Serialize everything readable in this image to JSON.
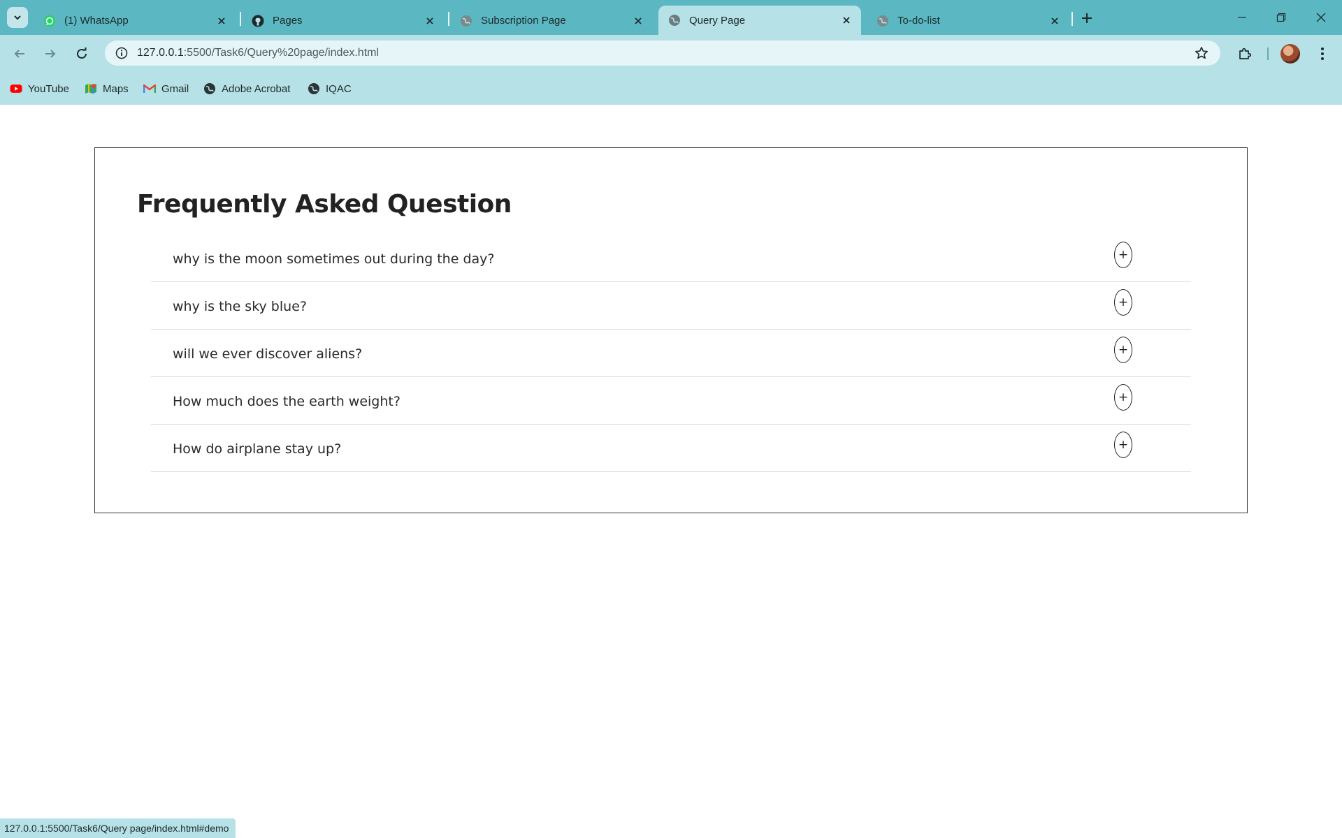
{
  "tabs": [
    {
      "title": "(1) WhatsApp",
      "icon": "whatsapp-icon"
    },
    {
      "title": "Pages",
      "icon": "github-icon"
    },
    {
      "title": "Subscription Page",
      "icon": "globe-icon"
    },
    {
      "title": "Query Page",
      "icon": "globe-icon",
      "active": true
    },
    {
      "title": "To-do-list",
      "icon": "globe-icon"
    }
  ],
  "address_bar": {
    "url_host": "127.0.0.1",
    "url_rest": ":5500/Task6/Query%20page/index.html"
  },
  "bookmarks": [
    {
      "label": "YouTube",
      "icon": "youtube-icon"
    },
    {
      "label": "Maps",
      "icon": "maps-icon"
    },
    {
      "label": "Gmail",
      "icon": "gmail-icon"
    },
    {
      "label": "Adobe Acrobat",
      "icon": "globe-icon"
    },
    {
      "label": "IQAC",
      "icon": "globe-icon"
    }
  ],
  "faq": {
    "title": "Frequently Asked Question",
    "toggle_symbol": "+",
    "questions": [
      "why is the moon sometimes out during the day?",
      "why is the sky blue?",
      "will we ever discover aliens?",
      "How much does the earth weight?",
      "How do airplane stay up?"
    ]
  },
  "status_bar": {
    "text": "127.0.0.1:5500/Task6/Query page/index.html#demo"
  },
  "colors": {
    "tabstrip_bg": "#5bb8c3",
    "toolbar_bg": "#b6e1e6",
    "omnibox_bg": "#e6f5f7"
  }
}
